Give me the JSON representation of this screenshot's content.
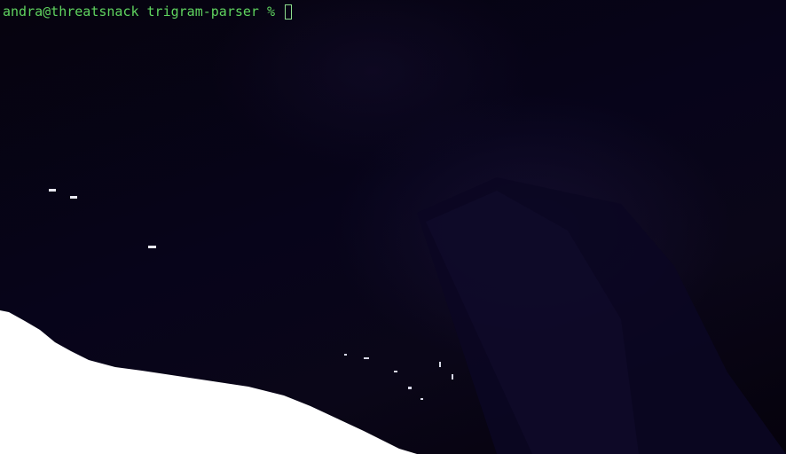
{
  "terminal": {
    "user_host": "andra@threatsnack",
    "directory": "trigram-parser",
    "prompt_symbol": "%",
    "input_value": ""
  },
  "colors": {
    "background": "#05020c",
    "prompt_text": "#5fd35f",
    "cursor": "#8fe08f",
    "snow": "#ffffff"
  },
  "icons": {
    "cursor": "block-cursor-icon"
  }
}
